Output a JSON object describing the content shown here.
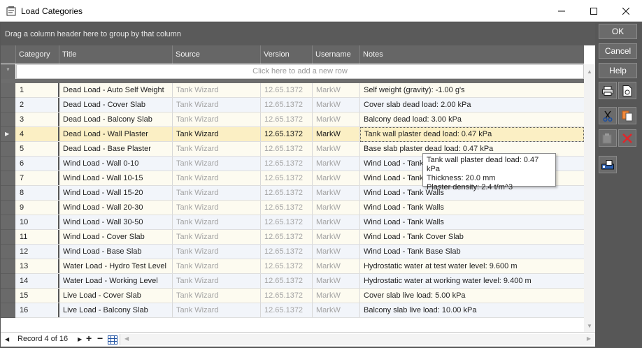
{
  "window": {
    "title": "Load Categories"
  },
  "group_panel": {
    "text": "Drag a column header here to group by that column"
  },
  "columns": [
    "Category",
    "Title",
    "Source",
    "Version",
    "Username",
    "Notes"
  ],
  "new_row": {
    "text": "Click here to add a new row",
    "indicator": "*"
  },
  "rows": [
    {
      "category": "1",
      "title": "Dead Load - Auto Self Weight",
      "source": "Tank Wizard",
      "version": "12.65.1372",
      "username": "MarkW",
      "notes": "Self weight (gravity): -1.00 g's"
    },
    {
      "category": "2",
      "title": "Dead Load - Cover Slab",
      "source": "Tank Wizard",
      "version": "12.65.1372",
      "username": "MarkW",
      "notes": "Cover slab dead load: 2.00 kPa"
    },
    {
      "category": "3",
      "title": "Dead Load - Balcony Slab",
      "source": "Tank Wizard",
      "version": "12.65.1372",
      "username": "MarkW",
      "notes": "Balcony dead load: 3.00 kPa"
    },
    {
      "category": "4",
      "title": "Dead Load - Wall Plaster",
      "source": "Tank Wizard",
      "version": "12.65.1372",
      "username": "MarkW",
      "notes": "Tank wall plaster dead load: 0.47 kPa"
    },
    {
      "category": "5",
      "title": "Dead Load - Base Plaster",
      "source": "Tank Wizard",
      "version": "12.65.1372",
      "username": "MarkW",
      "notes": "Base slab plaster dead load: 0.47 kPa"
    },
    {
      "category": "6",
      "title": "Wind Load - Wall 0-10",
      "source": "Tank Wizard",
      "version": "12.65.1372",
      "username": "MarkW",
      "notes": "Wind Load - Tank Walls"
    },
    {
      "category": "7",
      "title": "Wind Load - Wall 10-15",
      "source": "Tank Wizard",
      "version": "12.65.1372",
      "username": "MarkW",
      "notes": "Wind Load - Tank Walls"
    },
    {
      "category": "8",
      "title": "Wind Load - Wall 15-20",
      "source": "Tank Wizard",
      "version": "12.65.1372",
      "username": "MarkW",
      "notes": "Wind Load - Tank Walls"
    },
    {
      "category": "9",
      "title": "Wind Load - Wall 20-30",
      "source": "Tank Wizard",
      "version": "12.65.1372",
      "username": "MarkW",
      "notes": "Wind Load - Tank Walls"
    },
    {
      "category": "10",
      "title": "Wind Load - Wall 30-50",
      "source": "Tank Wizard",
      "version": "12.65.1372",
      "username": "MarkW",
      "notes": "Wind Load - Tank Walls"
    },
    {
      "category": "11",
      "title": "Wind Load - Cover Slab",
      "source": "Tank Wizard",
      "version": "12.65.1372",
      "username": "MarkW",
      "notes": "Wind Load - Tank Cover Slab"
    },
    {
      "category": "12",
      "title": "Wind Load - Base Slab",
      "source": "Tank Wizard",
      "version": "12.65.1372",
      "username": "MarkW",
      "notes": "Wind Load - Tank Base Slab"
    },
    {
      "category": "13",
      "title": "Water Load - Hydro Test Level",
      "source": "Tank Wizard",
      "version": "12.65.1372",
      "username": "MarkW",
      "notes": "Hydrostatic water at test water level: 9.600 m"
    },
    {
      "category": "14",
      "title": "Water Load - Working Level",
      "source": "Tank Wizard",
      "version": "12.65.1372",
      "username": "MarkW",
      "notes": "Hydrostatic water at working water level: 9.400 m"
    },
    {
      "category": "15",
      "title": "Live Load - Cover Slab",
      "source": "Tank Wizard",
      "version": "12.65.1372",
      "username": "MarkW",
      "notes": "Cover slab live load: 5.00 kPa"
    },
    {
      "category": "16",
      "title": "Live Load - Balcony Slab",
      "source": "Tank Wizard",
      "version": "12.65.1372",
      "username": "MarkW",
      "notes": "Balcony slab live load: 10.00 kPa"
    }
  ],
  "selected_row": 3,
  "tooltip": {
    "lines": [
      "Tank wall plaster dead load: 0.47 kPa",
      "Thickness: 20.0 mm",
      "Plaster density: 2.4 t/m^3"
    ]
  },
  "footer": {
    "record_text": "Record 4 of 16"
  },
  "buttons": {
    "ok": "OK",
    "cancel": "Cancel",
    "help": "Help"
  },
  "colors": {
    "selected_row": "#fbefc4",
    "panel": "#575757",
    "header": "#666666",
    "even_row": "#fdfbf0",
    "odd_row": "#f2f5fa"
  },
  "icons": [
    "print-icon",
    "export-icon",
    "cut-icon",
    "copy-icon",
    "paste-icon",
    "delete-icon",
    "import-icon"
  ]
}
